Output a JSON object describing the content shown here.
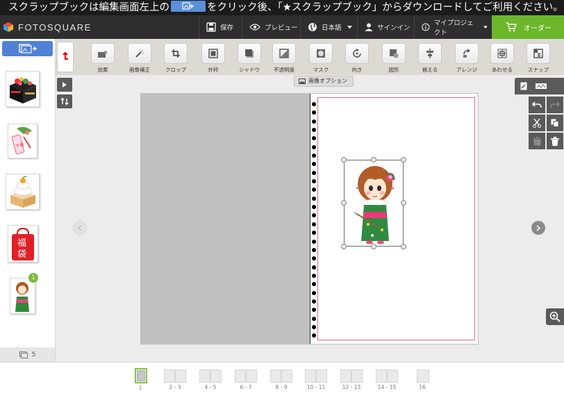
{
  "banner": {
    "text_before": "スクラップブックは編集画面左上の",
    "text_after": "をクリック後、「★スクラップブック」からダウンロードしてご利用ください。"
  },
  "app": {
    "logo": "FOTOSQUARE"
  },
  "nav": {
    "save": "保存",
    "preview": "プレビュー",
    "language": "日本語",
    "signin": "サインイン",
    "my_projects": "マイプロジェクト",
    "order": "オーダー"
  },
  "toolbar": {
    "items": [
      {
        "label": "効果",
        "icon": "effect-icon"
      },
      {
        "label": "画像補正",
        "icon": "magic-wand-icon"
      },
      {
        "label": "クロップ",
        "icon": "crop-icon"
      },
      {
        "label": "外枠",
        "icon": "frame-icon"
      },
      {
        "label": "シャドウ",
        "icon": "shadow-icon"
      },
      {
        "label": "不透明度",
        "icon": "opacity-icon"
      },
      {
        "label": "マスク",
        "icon": "mask-icon"
      },
      {
        "label": "向き",
        "icon": "rotate-icon"
      },
      {
        "label": "図形",
        "icon": "shape-icon"
      },
      {
        "label": "揃える",
        "icon": "align-icon"
      },
      {
        "label": "アレンジ",
        "icon": "arrange-icon"
      },
      {
        "label": "あわせる",
        "icon": "fit-icon"
      },
      {
        "label": "スナップ",
        "icon": "snap-icon"
      }
    ]
  },
  "image_options": "画像オプション",
  "photo_panel": {
    "count": "5",
    "badge": "1"
  },
  "pages": [
    {
      "label": "1"
    },
    {
      "label": "2 - 3"
    },
    {
      "label": "4 - 5"
    },
    {
      "label": "6 - 7"
    },
    {
      "label": "8 - 9"
    },
    {
      "label": "10 - 11"
    },
    {
      "label": "12 - 13"
    },
    {
      "label": "14 - 15"
    },
    {
      "label": "16"
    }
  ],
  "colors": {
    "order_green": "#6cb72b",
    "accent_blue": "#4f82d6",
    "bleed_red": "#e26a7a",
    "nav_dark": "#2e2e2e"
  }
}
